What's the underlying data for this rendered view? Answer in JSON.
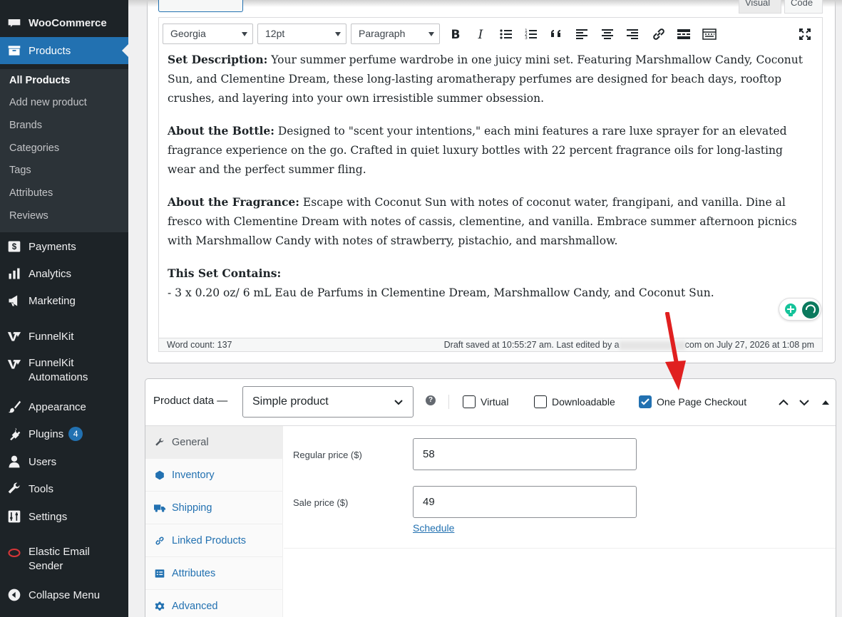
{
  "sidebar": {
    "brand_label": "WooCommerce",
    "products_label": "Products",
    "submenu": [
      "All Products",
      "Add new product",
      "Brands",
      "Categories",
      "Tags",
      "Attributes",
      "Reviews"
    ],
    "payments_label": "Payments",
    "analytics_label": "Analytics",
    "marketing_label": "Marketing",
    "funnelkit_label": "FunnelKit",
    "funnelkit_auto_line1": "FunnelKit",
    "funnelkit_auto_line2": "Automations",
    "appearance_label": "Appearance",
    "plugins_label": "Plugins",
    "plugins_badge": "4",
    "users_label": "Users",
    "tools_label": "Tools",
    "settings_label": "Settings",
    "elastic_line1": "Elastic Email",
    "elastic_line2": "Sender",
    "collapse_label": "Collapse Menu"
  },
  "editor": {
    "tab_visual": "Visual",
    "tab_code": "Code",
    "font_family": "Georgia",
    "font_size": "12pt",
    "format": "Paragraph",
    "p1_bold": "Set Description:",
    "p1_text": " Your summer perfume wardrobe in one juicy mini set. Featuring Marshmallow Candy, Coconut Sun, and Clementine Dream, these long-lasting aromatherapy perfumes are designed for beach days, rooftop crushes, and layering into your own irresistible summer obsession.",
    "p2_bold": "About the Bottle:",
    "p2_text": " Designed to \"scent your intentions,\" each mini features a rare luxe sprayer for an elevated fragrance experience on the go. Crafted in quiet luxury bottles with 22 percent fragrance oils for long-lasting wear and the perfect summer fling.",
    "p3_bold": "About the Fragrance:",
    "p3_text": " Escape with Coconut Sun with notes of coconut water, frangipani, and vanilla. Dine al fresco with Clementine Dream with notes of cassis, clementine, and vanilla. Embrace summer afternoon picnics with Marshmallow Candy with notes of strawberry, pistachio, and marshmallow.",
    "p4_bold": "This Set Contains:",
    "p4_text": "- 3 x 0.20 oz/ 6 mL Eau de Parfums in Clementine Dream, Marshmallow Candy, and Coconut Sun.",
    "word_count": "Word count: 137",
    "draft_status_prefix": "Draft saved at 10:55:27 am. Last edited by a",
    "draft_status_suffix": "com on July 27, 2026 at 1:08 pm"
  },
  "product_data": {
    "title": "Product data —",
    "product_type": "Simple product",
    "virtual_label": "Virtual",
    "virtual_checked": false,
    "downloadable_label": "Downloadable",
    "downloadable_checked": false,
    "one_page_label": "One Page Checkout",
    "one_page_checked": true,
    "tabs": [
      "General",
      "Inventory",
      "Shipping",
      "Linked Products",
      "Attributes",
      "Advanced"
    ],
    "regular_price_label": "Regular price ($)",
    "regular_price": "58",
    "sale_price_label": "Sale price ($)",
    "sale_price": "49",
    "schedule_link": "Schedule"
  },
  "colors": {
    "sidebar_bg": "#1d2327",
    "accent": "#2271b1",
    "annotation_arrow": "#e02020"
  }
}
